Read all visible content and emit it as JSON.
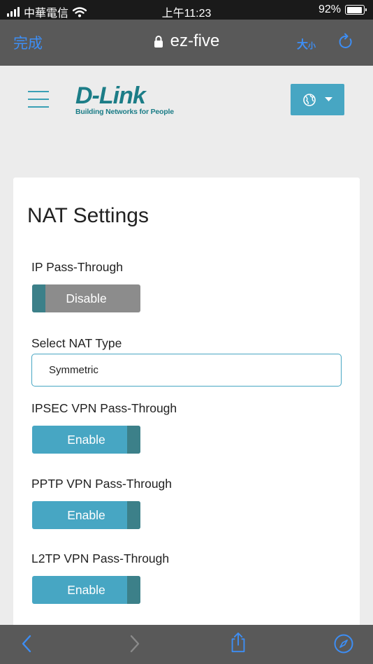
{
  "status_bar": {
    "carrier": "中華電信",
    "time": "上午11:23",
    "battery": "92%",
    "battery_level": 0.92
  },
  "browser": {
    "done_label": "完成",
    "url": "ez-five",
    "text_size_main": "大",
    "text_size_small": "小"
  },
  "header": {
    "brand": "D-Link",
    "tagline": "Building Networks for People"
  },
  "nat": {
    "title": "NAT Settings",
    "ip_passthrough": {
      "label": "IP Pass-Through",
      "state": "Disable"
    },
    "nat_type": {
      "label": "Select NAT Type",
      "value": "Symmetric"
    },
    "ipsec": {
      "label": "IPSEC VPN Pass-Through",
      "state": "Enable"
    },
    "pptp": {
      "label": "PPTP VPN Pass-Through",
      "state": "Enable"
    },
    "l2tp": {
      "label": "L2TP VPN Pass-Through",
      "state": "Enable"
    }
  },
  "colors": {
    "accent": "#47a6c3",
    "knob": "#3c8089",
    "disabled": "#8c8c8c",
    "ios_blue": "#3d8ef5",
    "brand": "#1c7d87"
  },
  "icons": [
    "signal-icon",
    "wifi-icon",
    "battery-icon",
    "lock-icon",
    "reload-icon",
    "hamburger-icon",
    "globe-icon",
    "caret-down-icon",
    "back-icon",
    "forward-icon",
    "share-icon",
    "compass-icon"
  ]
}
